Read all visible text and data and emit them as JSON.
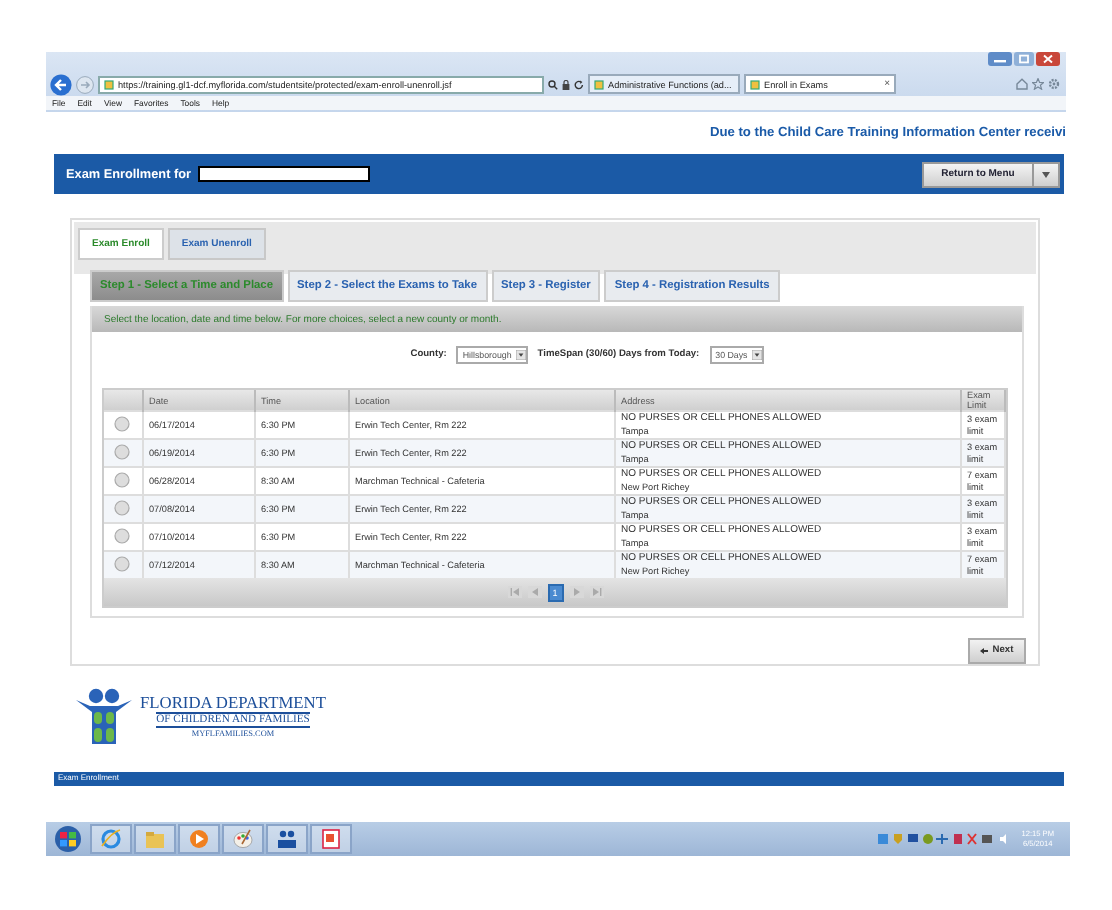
{
  "browser": {
    "address": "https://training.gl1-dcf.myflorida.com/studentsite/protected/exam-enroll-unenroll.jsf",
    "tabs": [
      {
        "label": "Administrative Functions (ad...",
        "selected": false
      },
      {
        "label": "Enroll in Exams",
        "selected": true
      }
    ],
    "tab_close": "×",
    "menu": [
      "File",
      "Edit",
      "View",
      "Favorites",
      "Tools",
      "Help"
    ]
  },
  "notice": "Due to the Child Care Training Information Center receivi",
  "header": {
    "title": "Exam Enrollment for",
    "return_button": "Return to Menu"
  },
  "tabs": [
    {
      "label": "Exam Enroll",
      "selected": true
    },
    {
      "label": "Exam Unenroll",
      "selected": false
    }
  ],
  "steps": [
    {
      "label": "Step 1 - Select a Time and Place",
      "selected": true
    },
    {
      "label": "Step 2 - Select the Exams to Take",
      "selected": false
    },
    {
      "label": "Step 3 - Register",
      "selected": false
    },
    {
      "label": "Step 4 - Registration Results",
      "selected": false
    }
  ],
  "instruction": "Select the location, date and time below. For more choices, select a new county or month.",
  "filters": {
    "county_label": "County:",
    "county": "Hillsborough",
    "timespan_label": "TimeSpan (30/60) Days from Today:",
    "timespan": "30 Days"
  },
  "table": {
    "columns": [
      "Date",
      "Time",
      "Location",
      "Address",
      "Exam Limit"
    ],
    "rows": [
      {
        "selected": false,
        "date": "06/17/2014",
        "time": "6:30 PM",
        "location": "Erwin Tech Center, Rm 222",
        "note": "NO PURSES OR CELL PHONES ALLOWED",
        "city": "Tampa",
        "limit": "3 exam limit"
      },
      {
        "selected": false,
        "date": "06/19/2014",
        "time": "6:30 PM",
        "location": "Erwin Tech Center, Rm 222",
        "note": "NO PURSES OR CELL PHONES ALLOWED",
        "city": "Tampa",
        "limit": "3 exam limit"
      },
      {
        "selected": false,
        "date": "06/28/2014",
        "time": "8:30 AM",
        "location": "Marchman Technical - Cafeteria",
        "note": "NO PURSES OR CELL PHONES ALLOWED",
        "city": "New Port Richey",
        "limit": "7 exam limit"
      },
      {
        "selected": false,
        "date": "07/08/2014",
        "time": "6:30 PM",
        "location": "Erwin Tech Center, Rm 222",
        "note": "NO PURSES OR CELL PHONES ALLOWED",
        "city": "Tampa",
        "limit": "3 exam limit"
      },
      {
        "selected": false,
        "date": "07/10/2014",
        "time": "6:30 PM",
        "location": "Erwin Tech Center, Rm 222",
        "note": "NO PURSES OR CELL PHONES ALLOWED",
        "city": "Tampa",
        "limit": "3 exam limit"
      },
      {
        "selected": false,
        "date": "07/12/2014",
        "time": "8:30 AM",
        "location": "Marchman Technical - Cafeteria",
        "note": "NO PURSES OR CELL PHONES ALLOWED",
        "city": "New Port Richey",
        "limit": "7 exam limit"
      }
    ]
  },
  "pager": {
    "pages": [
      {
        "label": "1",
        "selected": true
      }
    ]
  },
  "next_button": "Next",
  "logo": {
    "line1": "FLORIDA DEPARTMENT",
    "line2": "OF CHILDREN AND FAMILIES",
    "line3": "MYFLFAMILIES.COM"
  },
  "footer": "Exam Enrollment",
  "taskbar": {
    "time": "12:15 PM",
    "date": "6/5/2014"
  }
}
